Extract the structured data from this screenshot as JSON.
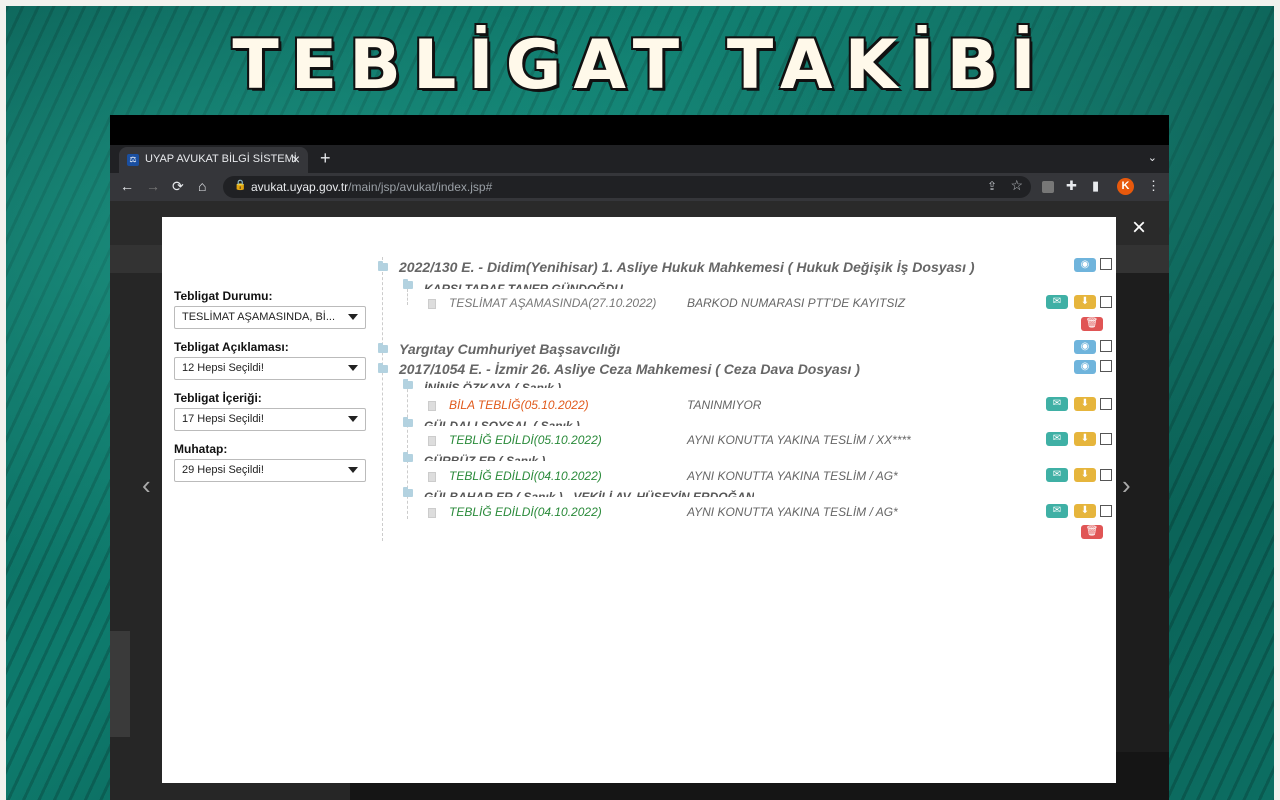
{
  "banner": {
    "title": "TEBLİGAT TAKİBİ"
  },
  "browser": {
    "tab_title": "UYAP AVUKAT BİLGİ SİSTEMİ",
    "tab_favicon": "UYAP",
    "tab_close": "×",
    "new_tab": "+",
    "tab_menu": "⌄",
    "back": "←",
    "forward": "→",
    "reload": "⟳",
    "home": "⌂",
    "url_domain": "avukat.uyap.gov.tr",
    "url_path": "/main/jsp/avukat/index.jsp#",
    "profile_letter": "K"
  },
  "modal": {
    "close": "×",
    "prev": "‹",
    "next": "›",
    "filters": [
      {
        "label": "Tebligat Durumu:",
        "value": "TESLİMAT AŞAMASINDA, Bİ..."
      },
      {
        "label": "Tebligat Açıklaması:",
        "value": "12 Hepsi Seçildi!"
      },
      {
        "label": "Tebligat İçeriği:",
        "value": "17 Hepsi Seçildi!"
      },
      {
        "label": "Muhatap:",
        "value": "29 Hepsi Seçildi!"
      }
    ],
    "cases": {
      "c1": "2022/130 E. - Didim(Yenihisar) 1. Asliye Hukuk Mahkemesi ( Hukuk Değişik İş Dosyası )",
      "c1_sub": "KARŞI TARAF TANER GÜNDOĞDU",
      "c2": "Yargıtay Cumhuriyet Başsavcılığı",
      "c3": "2017/1054 E. - İzmir 26. Asliye Ceza Mahkemesi ( Ceza Dava Dosyası )",
      "c3_sub1": "İNİNİS ÖZKAYA ( Sanık )",
      "c3_sub2": "GÜLDALI SOYSAL ( Sanık )",
      "c3_sub3": "GÜRBÜZ ER ( Sanık )",
      "c3_sub4": "GÜLBAHAR ER ( Sanık ) - VEKİLİ AV. HÜSEYİN ERDOĞAN"
    },
    "notices": [
      {
        "status": "TESLİMAT AŞAMASINDA(27.10.2022)",
        "desc": "BARKOD NUMARASI PTT'DE KAYITSIZ",
        "color": "#777777"
      },
      {
        "status": "BİLA TEBLİĞ(05.10.2022)",
        "desc": "TANINMIYOR",
        "color": "#e05a1c"
      },
      {
        "status": "TEBLİĞ EDİLDİ(05.10.2022)",
        "desc": "AYNI KONUTTA YAKINA TESLİM / XX****",
        "color": "#2a8a3a"
      },
      {
        "status": "TEBLİĞ EDİLDİ(04.10.2022)",
        "desc": "AYNI KONUTTA YAKINA TESLİM / AG*",
        "color": "#2a8a3a"
      },
      {
        "status": "TEBLİĞ EDİLDİ(04.10.2022)",
        "desc": "AYNI KONUTTA YAKINA TESLİM / AG*",
        "color": "#2a8a3a"
      }
    ],
    "icons": {
      "eye": "◉",
      "chat": "✉",
      "download": "⬇",
      "delete": "🗑"
    }
  }
}
